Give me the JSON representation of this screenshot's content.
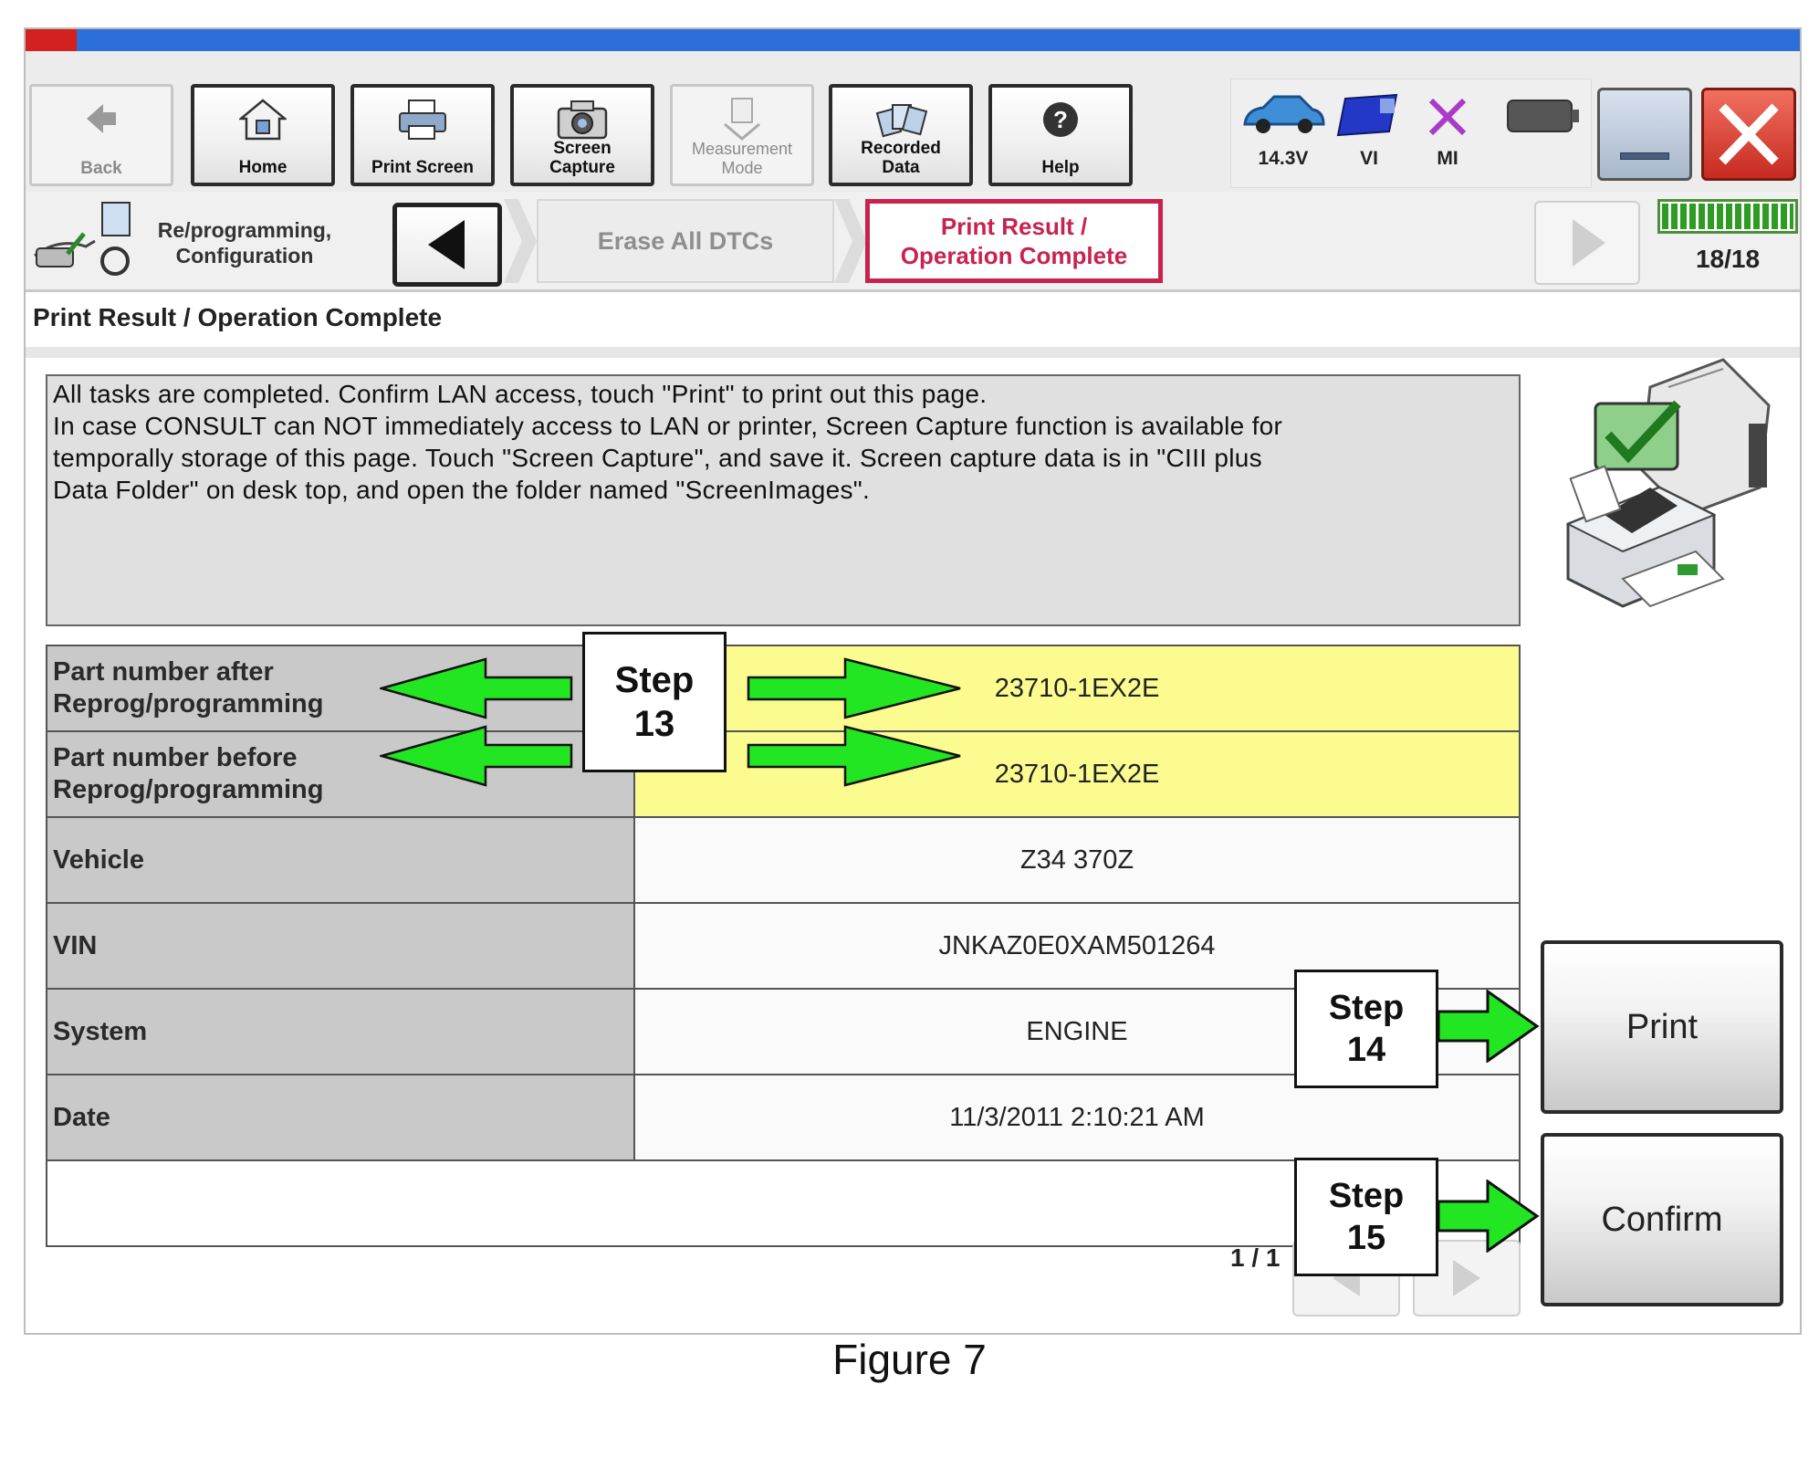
{
  "toolbar": {
    "back": "Back",
    "home": "Home",
    "print_screen": "Print Screen",
    "screen_capture": [
      "Screen",
      "Capture"
    ],
    "measurement_mode": [
      "Measurement",
      "Mode"
    ],
    "recorded_data": [
      "Recorded",
      "Data"
    ],
    "help": "Help",
    "voltage": "14.3V",
    "vi": "VI",
    "mi": "MI"
  },
  "nav": {
    "section_label": [
      "Re/programming,",
      "Configuration"
    ],
    "prev_step": "Erase All DTCs",
    "current_step": [
      "Print Result /",
      "Operation Complete"
    ],
    "progress": "18/18",
    "progress_fraction": 1.0
  },
  "page_title": "Print Result / Operation Complete",
  "message": [
    "All tasks are completed. Confirm LAN access, touch \"Print\" to print out this page.",
    "In case CONSULT can NOT immediately access to LAN or printer, Screen Capture function is available for",
    "temporally storage of this page. Touch \"Screen Capture\", and save it. Screen capture data is in \"CIII plus",
    "Data Folder\" on desk top, and open the folder named \"ScreenImages\"."
  ],
  "table": [
    {
      "label": [
        "Part number after",
        "Reprog/programming"
      ],
      "value": "23710-1EX2E",
      "highlight": true
    },
    {
      "label": [
        "Part number before",
        "Reprog/programming"
      ],
      "value": "23710-1EX2E",
      "highlight": true
    },
    {
      "label": [
        "Vehicle"
      ],
      "value": "Z34 370Z",
      "highlight": false
    },
    {
      "label": [
        "VIN"
      ],
      "value": "JNKAZ0E0XAM501264",
      "highlight": false
    },
    {
      "label": [
        "System"
      ],
      "value": "ENGINE",
      "highlight": false
    },
    {
      "label": [
        "Date"
      ],
      "value": "11/3/2011 2:10:21 AM",
      "highlight": false
    }
  ],
  "pagination": "1 / 1",
  "buttons": {
    "print": "Print",
    "confirm": "Confirm"
  },
  "annotations": {
    "step13": [
      "Step",
      "13"
    ],
    "step14": [
      "Step",
      "14"
    ],
    "step15": [
      "Step",
      "15"
    ],
    "arrow_color": "#22e622"
  },
  "caption": "Figure 7",
  "colors": {
    "active_step": "#c8234f",
    "highlight_row": "#fbfb8f",
    "progress": "#2e9c23"
  }
}
